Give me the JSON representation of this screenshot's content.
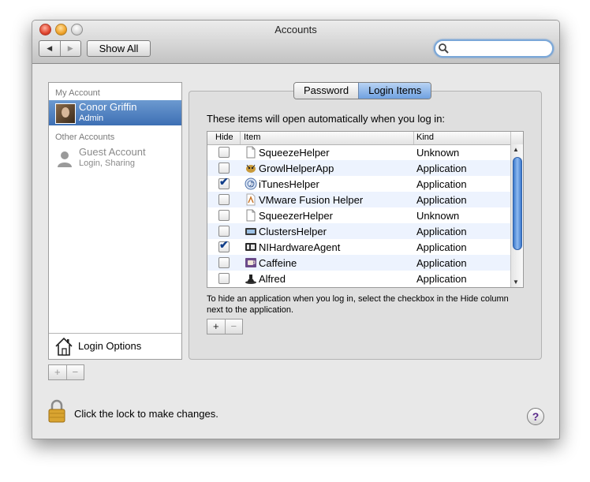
{
  "window": {
    "title": "Accounts"
  },
  "toolbar": {
    "back_glyph": "◀",
    "forward_glyph": "▶",
    "show_all_label": "Show All",
    "search_value": "",
    "search_placeholder": ""
  },
  "accounts": {
    "my_account_header": "My Account",
    "current_user": {
      "name": "Conor Griffin",
      "role": "Admin"
    },
    "other_accounts_header": "Other Accounts",
    "guest": {
      "name": "Guest Account",
      "subtitle": "Login, Sharing"
    },
    "login_options_label": "Login Options",
    "add_label": "+",
    "remove_label": "−"
  },
  "tabs": [
    {
      "label": "Password",
      "active": false
    },
    {
      "label": "Login Items",
      "active": true
    }
  ],
  "login_items": {
    "intro": "These items will open automatically when you log in:",
    "columns": {
      "hide": "Hide",
      "item": "Item",
      "kind": "Kind"
    },
    "rows": [
      {
        "hide": false,
        "name": "SqueezeHelper",
        "kind": "Unknown",
        "icon": "document-icon"
      },
      {
        "hide": false,
        "name": "GrowlHelperApp",
        "kind": "Application",
        "icon": "growl-icon"
      },
      {
        "hide": true,
        "name": "iTunesHelper",
        "kind": "Application",
        "icon": "itunes-icon"
      },
      {
        "hide": false,
        "name": "VMware Fusion Helper",
        "kind": "Application",
        "icon": "vmware-icon"
      },
      {
        "hide": false,
        "name": "SqueezerHelper",
        "kind": "Unknown",
        "icon": "document-icon"
      },
      {
        "hide": false,
        "name": "ClustersHelper",
        "kind": "Application",
        "icon": "clusters-icon"
      },
      {
        "hide": true,
        "name": "NIHardwareAgent",
        "kind": "Application",
        "icon": "ni-icon"
      },
      {
        "hide": false,
        "name": "Caffeine",
        "kind": "Application",
        "icon": "caffeine-icon"
      },
      {
        "hide": false,
        "name": "Alfred",
        "kind": "Application",
        "icon": "alfred-icon"
      }
    ],
    "check_glyph": "✔",
    "scroll_up_glyph": "▲",
    "scroll_down_glyph": "▼",
    "hint": "To hide an application when you log in, select the checkbox in the Hide column next to the application.",
    "add_label": "+",
    "remove_label": "−"
  },
  "footer": {
    "lock_label": "Click the lock to make changes.",
    "help_label": "?"
  },
  "colors": {
    "selection": "#3d6fb4",
    "tab_active": "#6fa1e1",
    "row_alt": "#edf3fe"
  }
}
